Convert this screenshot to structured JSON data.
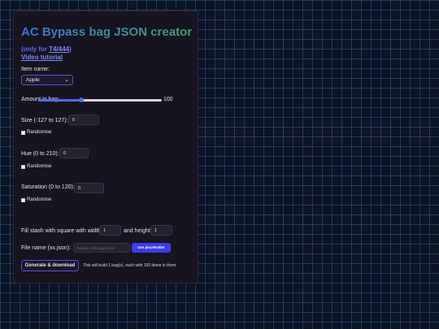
{
  "title": {
    "part1": "AC Bypass bag ",
    "part2": "JSON creator"
  },
  "subtitle": {
    "prefix": "(only for ",
    "link": "T4/444",
    "suffix": ")",
    "video": "Video tutorial"
  },
  "item": {
    "label": "Item name:",
    "value": "Apple"
  },
  "amount": {
    "label": "Amount in bag:",
    "value": "100",
    "fraction": 0.35
  },
  "size": {
    "label": "Size (-127 to 127):",
    "value": "0",
    "randomise": "Randomise"
  },
  "hue": {
    "label": "Hue (0 to 210):",
    "value": "0",
    "randomise": "Randomise"
  },
  "saturation": {
    "label": "Saturation (0 to 120):",
    "value": "0",
    "randomise": "Randomise"
  },
  "stash": {
    "label_width": "Fill stash with square with width",
    "width": "1",
    "label_height": "and height",
    "height": "1"
  },
  "filename": {
    "label": "File name (xx.json):",
    "placeholder": "bypass-100x-apple.json",
    "button": "Use placeholder"
  },
  "generate": {
    "button": "Generate & download",
    "note": "This will build 1 bag(s), each with 100 items in them."
  },
  "colors": {
    "accent": "#3b3cf0",
    "title_blue": "#3d74d8",
    "title_green": "#3aa36b"
  }
}
